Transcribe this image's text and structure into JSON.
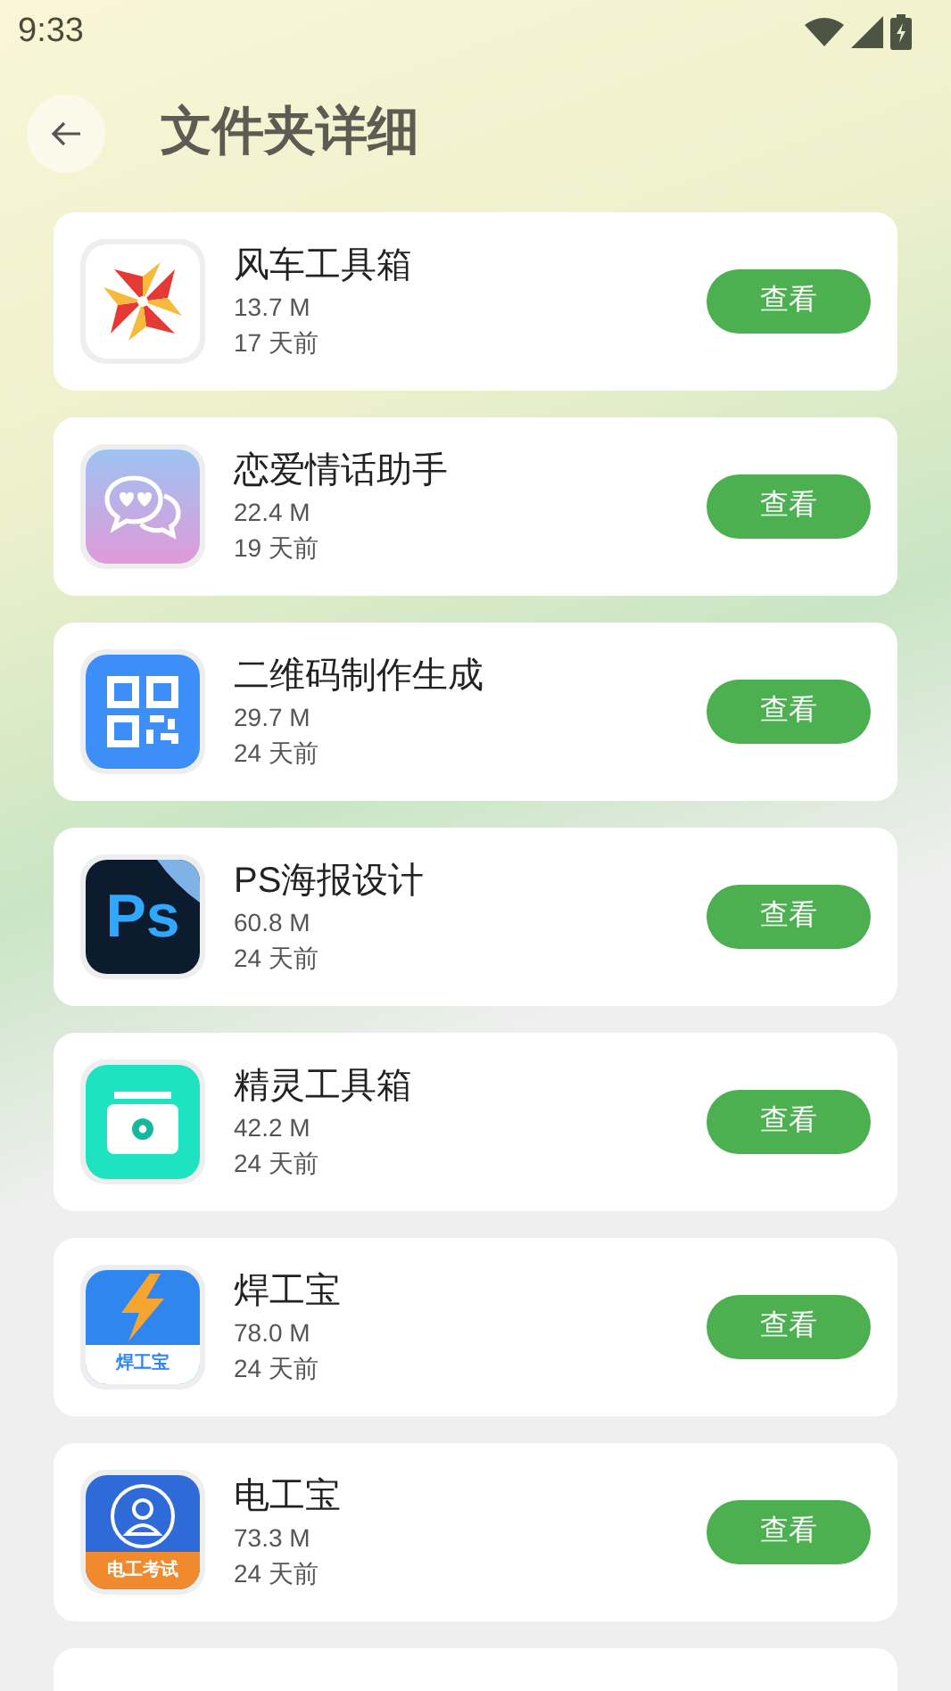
{
  "status_bar": {
    "time": "9:33"
  },
  "header": {
    "title": "文件夹详细"
  },
  "apps": [
    {
      "kind": "pinwheel",
      "name": "风车工具箱",
      "size": "13.7 M",
      "age": "17 天前",
      "action": "查看"
    },
    {
      "kind": "chat",
      "name": "恋爱情话助手",
      "size": "22.4 M",
      "age": "19 天前",
      "action": "查看"
    },
    {
      "kind": "qr",
      "name": "二维码制作生成",
      "size": "29.7 M",
      "age": "24 天前",
      "action": "查看"
    },
    {
      "kind": "ps",
      "name": "PS海报设计",
      "size": "60.8 M",
      "age": "24 天前",
      "action": "查看",
      "icon_text": "Ps"
    },
    {
      "kind": "toolbox",
      "name": "精灵工具箱",
      "size": "42.2 M",
      "age": "24 天前",
      "action": "查看"
    },
    {
      "kind": "bolt",
      "name": "焊工宝",
      "size": "78.0 M",
      "age": "24 天前",
      "action": "查看",
      "icon_text": "焊工宝"
    },
    {
      "kind": "worker",
      "name": "电工宝",
      "size": "73.3 M",
      "age": "24 天前",
      "action": "查看",
      "icon_text": "电工考试"
    }
  ]
}
